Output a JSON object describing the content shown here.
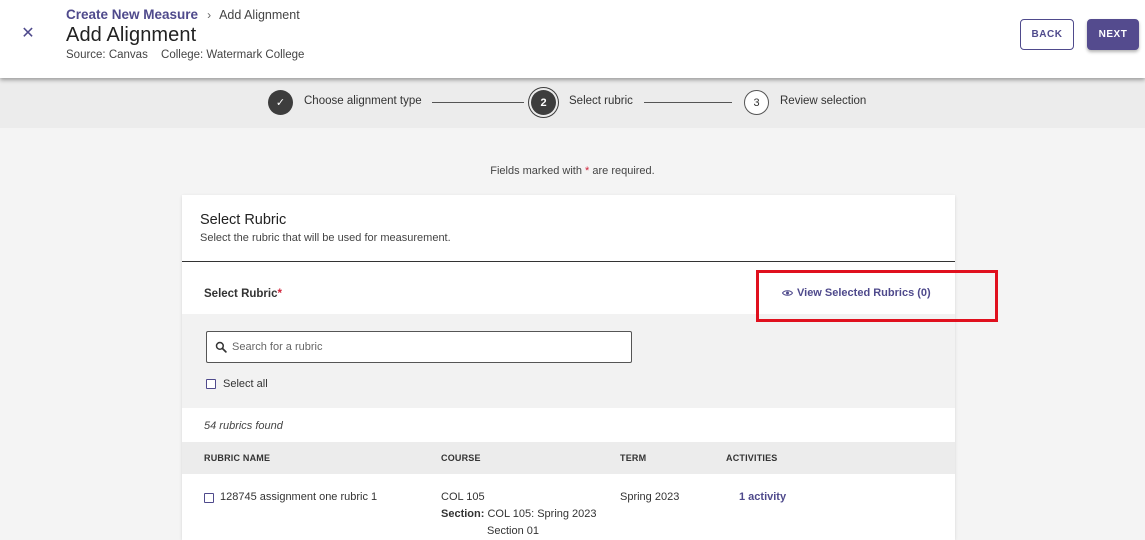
{
  "header": {
    "breadcrumb_parent": "Create New Measure",
    "breadcrumb_separator": "›",
    "breadcrumb_current": "Add Alignment",
    "title": "Add Alignment",
    "source": "Source: Canvas",
    "college": "College: Watermark College",
    "back_label": "BACK",
    "next_label": "NEXT"
  },
  "stepper": {
    "steps": [
      {
        "number": "✓",
        "label": "Choose alignment type",
        "status": "complete"
      },
      {
        "number": "2",
        "label": "Select rubric",
        "status": "active"
      },
      {
        "number": "3",
        "label": "Review selection",
        "status": "upcoming"
      }
    ]
  },
  "required_note": {
    "before": "Fields marked with",
    "star": "*",
    "after": "are required."
  },
  "card": {
    "title": "Select Rubric",
    "subtitle": "Select the rubric that will be used for measurement.",
    "select_label": "Select Rubric",
    "required_star": "*",
    "view_selected": "View Selected Rubrics (0)",
    "search_placeholder": "Search for a rubric",
    "select_all": "Select all",
    "found_text": "54 rubrics found",
    "columns": [
      "RUBRIC NAME",
      "COURSE",
      "TERM",
      "ACTIVITIES"
    ],
    "rows": [
      {
        "name": "128745 assignment one rubric 1",
        "course": "COL 105",
        "section_label": "Section:",
        "section_value": "COL 105: Spring 2023",
        "section_value_2": "Section 01",
        "term": "Spring 2023",
        "activities": "1 activity"
      }
    ]
  },
  "colors": {
    "accent": "#4f4a8c",
    "required": "#d0243b",
    "highlight": "#e0101e"
  }
}
